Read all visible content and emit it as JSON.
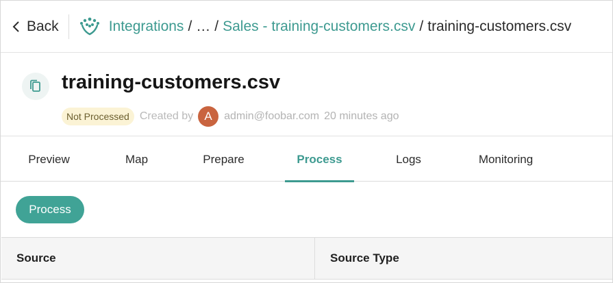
{
  "breadcrumb": {
    "back_label": "Back",
    "items": [
      "Integrations",
      "…",
      "Sales - training-customers.csv"
    ],
    "separator": "/",
    "current": "training-customers.csv"
  },
  "header": {
    "title": "training-customers.csv",
    "status_badge": "Not Processed",
    "created_by_label": "Created by",
    "avatar_initial": "A",
    "email": "admin@foobar.com",
    "time_ago": "20 minutes ago"
  },
  "tabs": [
    {
      "label": "Preview",
      "active": false
    },
    {
      "label": "Map",
      "active": false
    },
    {
      "label": "Prepare",
      "active": false
    },
    {
      "label": "Process",
      "active": true
    },
    {
      "label": "Logs",
      "active": false
    },
    {
      "label": "Monitoring",
      "active": false
    }
  ],
  "action": {
    "process_label": "Process"
  },
  "table": {
    "columns": [
      "Source",
      "Source Type"
    ]
  },
  "colors": {
    "accent": "#3d9a90",
    "badge_bg": "#fbf3d5",
    "avatar_bg": "#c9643f"
  }
}
